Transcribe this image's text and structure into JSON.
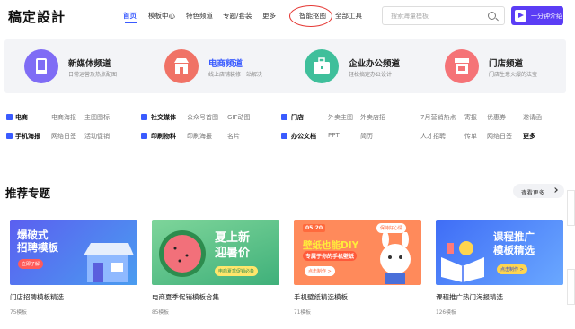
{
  "header": {
    "logo": "稿定設計",
    "nav": [
      "首页",
      "模板中心",
      "特色频道",
      "专题/套装",
      "更多",
      "智能抠图",
      "全部工具"
    ],
    "search_placeholder": "搜索海量模板",
    "cta_label": "一分钟介绍",
    "accent": "#3a5bff"
  },
  "channels": [
    {
      "title": "新媒体频道",
      "desc": "日常运营及热点配图",
      "color": "#7f6cf5",
      "icon": "phone-icon"
    },
    {
      "title": "电商频道",
      "desc": "线上店铺装修一站解决",
      "color": "#f07266",
      "icon": "shop-icon",
      "title_color": "#3a5bff"
    },
    {
      "title": "企业办公频道",
      "desc": "轻松搞定办公设计",
      "color": "#3fbf9b",
      "icon": "briefcase-icon"
    },
    {
      "title": "门店频道",
      "desc": "门店生意火爆的法宝",
      "color": "#f57377",
      "icon": "store-icon"
    }
  ],
  "categories": {
    "row1": [
      "电商",
      "电商海报",
      "主图图标",
      "社交媒体",
      "公众号首图",
      "GIF动图",
      "门店",
      "外卖主图",
      "外卖店招",
      "7月营销热点",
      "寄报",
      "优惠券",
      "邀请函"
    ],
    "row2": [
      "手机海报",
      "网络日签",
      "活动促销",
      "印刷物料",
      "印刷海报",
      "名片",
      "办公文档",
      "PPT",
      "简历",
      "人才招聘",
      "传单",
      "网络日签",
      "更多"
    ]
  },
  "recommended": {
    "title": "推荐专题",
    "more": "查看更多",
    "cards": [
      {
        "name": "门店招聘模板精选",
        "count": "75模板",
        "headline": "爆破式\n招聘模板",
        "pill": "立即了解"
      },
      {
        "name": "电商夏季促销模板合集",
        "count": "85模板",
        "headline": "夏上新\n迎暑价",
        "pill": "电商夏季促销必备"
      },
      {
        "name": "手机壁纸精选模板",
        "count": "71模板",
        "headline": "壁纸也能DIY",
        "sub": "专属于你的手机壁纸",
        "pill": "点击制作 >",
        "tag": "05:20",
        "tag2": "保持好心情"
      },
      {
        "name": "课程推广热门海报精选",
        "count": "126模板",
        "headline": "课程推广\n模板精选",
        "pill": "点击制作 >"
      }
    ]
  }
}
